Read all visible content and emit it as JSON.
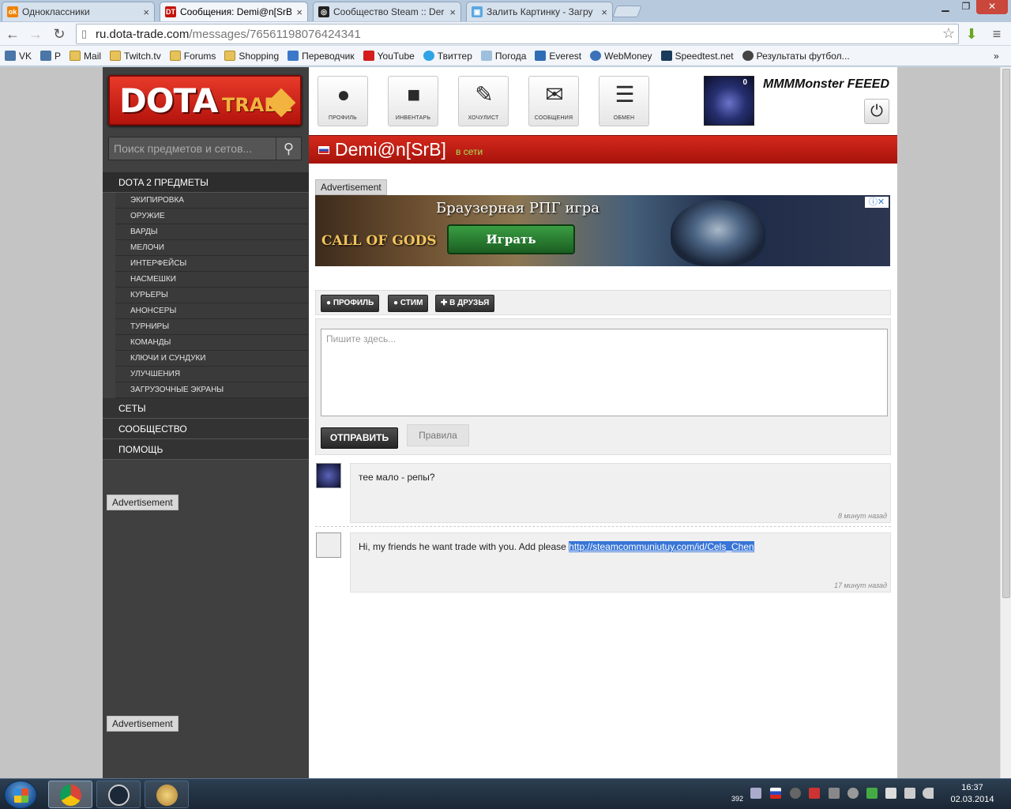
{
  "browser": {
    "tabs": [
      {
        "title": "Одноклассники",
        "fav": "ok",
        "color": "#f08200",
        "active": false
      },
      {
        "title": "Сообщения: Demi@n[SrB",
        "fav": "DT",
        "color": "#c4150b",
        "active": true
      },
      {
        "title": "Сообщество Steam :: Der",
        "fav": "steam",
        "color": "#222222",
        "active": false
      },
      {
        "title": "Залить Картинку - Загру",
        "fav": "img",
        "color": "#5aa8e0",
        "active": false
      }
    ],
    "url_host": "ru.dota-trade.com",
    "url_path": "/messages/76561198076424341",
    "bookmarks": [
      {
        "label": "VK",
        "icon": "vk-icon"
      },
      {
        "label": "P",
        "icon": "vk-icon"
      },
      {
        "label": "Mail",
        "icon": "folder-icon"
      },
      {
        "label": "Twitch.tv",
        "icon": "folder-icon"
      },
      {
        "label": "Forums",
        "icon": "folder-icon"
      },
      {
        "label": "Shopping",
        "icon": "folder-icon"
      },
      {
        "label": "Переводчик",
        "icon": "translate-icon"
      },
      {
        "label": "YouTube",
        "icon": "youtube-icon"
      },
      {
        "label": "Твиттер",
        "icon": "twitter-icon"
      },
      {
        "label": "Погода",
        "icon": "weather-icon"
      },
      {
        "label": "Everest",
        "icon": "everest-icon"
      },
      {
        "label": "WebMoney",
        "icon": "webmoney-icon"
      },
      {
        "label": "Speedtest.net",
        "icon": "speedtest-icon"
      },
      {
        "label": "Результаты футбол...",
        "icon": "football-icon"
      }
    ],
    "more_bookmarks": "»"
  },
  "site": {
    "logo_dota": "DOTA",
    "logo_trade": "TRADE",
    "search_placeholder": "Поиск предметов и сетов...",
    "menu": {
      "section1": "DOTA 2 ПРЕДМЕТЫ",
      "items": [
        "ЭКИПИРОВКА",
        "ОРУЖИЕ",
        "ВАРДЫ",
        "МЕЛОЧИ",
        "ИНТЕРФЕЙСЫ",
        "НАСМЕШКИ",
        "КУРЬЕРЫ",
        "АНОНСЕРЫ",
        "ТУРНИРЫ",
        "КОМАНДЫ",
        "КЛЮЧИ И СУНДУКИ",
        "УЛУЧШЕНИЯ",
        "ЗАГРУЗОЧНЫЕ ЭКРАНЫ"
      ],
      "sections": [
        "СЕТЫ",
        "СООБЩЕСТВО",
        "ПОМОЩЬ"
      ]
    },
    "ad_label": "Advertisement",
    "nav": [
      {
        "label": "ПРОФИЛЬ",
        "icon": "user-icon"
      },
      {
        "label": "ИНВЕНТАРЬ",
        "icon": "briefcase-icon"
      },
      {
        "label": "ХОЧУЛИСТ",
        "icon": "edit-icon"
      },
      {
        "label": "СООБЩЕНИЯ",
        "icon": "envelope-icon"
      },
      {
        "label": "ОБМЕН",
        "icon": "list-icon"
      }
    ],
    "user": {
      "name": "MMMMonster FEEED",
      "notif_count": "0"
    },
    "conversation": {
      "partner": "Demi@n[SrB]",
      "status": "в сети"
    },
    "banner": {
      "game": "CALL OF GODS",
      "headline": "Браузерная РПГ игра",
      "cta": "Играть"
    },
    "actions": [
      {
        "label": "ПРОФИЛЬ",
        "icon": "user-icon"
      },
      {
        "label": "СТИМ",
        "icon": "user-icon"
      },
      {
        "label": "В ДРУЗЬЯ",
        "icon": "plus-icon"
      }
    ],
    "composer": {
      "placeholder": "Пишите здесь...",
      "send": "ОТПРАВИТЬ",
      "rules": "Правила"
    },
    "messages": [
      {
        "text": "тее мало - репы?",
        "time": "8 минут назад"
      },
      {
        "text_before": "Hi, my friends he want trade with you. Add please ",
        "link": "http://steamcommuniutuy.com/id/Cels_Chen",
        "time": "17 минут назад"
      }
    ]
  },
  "taskbar": {
    "time": "16:37",
    "date": "02.03.2014",
    "tray_badge": "392"
  }
}
